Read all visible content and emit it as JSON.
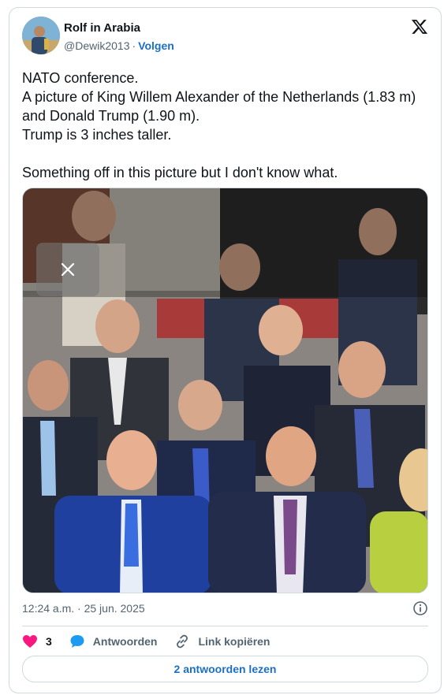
{
  "author": {
    "name": "Rolf in Arabia",
    "handle": "@Dewik2013",
    "separator": "·",
    "follow": "Volgen"
  },
  "post": {
    "text": "NATO conference.\nA picture of King Willem Alexander of the Netherlands (1.83 m) and Donald Trump (1.90 m).\nTrump is 3 inches taller.\n\nSomething off in this picture but I don't know what."
  },
  "meta": {
    "timestamp": "12:24 a.m. · 25 jun. 2025"
  },
  "actions": {
    "likes": "3",
    "reply_label": "Antwoorden",
    "copy_label": "Link kopiëren"
  },
  "read_replies": "2 antwoorden lezen",
  "colors": {
    "accent": "#1d6fc4",
    "like": "#f91880",
    "reply": "#1d9bf0",
    "border": "#cfd9de",
    "muted": "#536471"
  },
  "icons": [
    "x-logo-icon",
    "close-icon",
    "info-icon",
    "heart-icon",
    "reply-icon",
    "link-icon"
  ]
}
